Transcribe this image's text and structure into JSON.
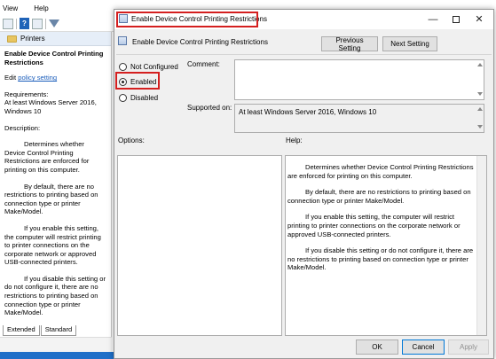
{
  "background": {
    "menu": [
      "View",
      "Help"
    ],
    "pane_header": "Printers",
    "pane_title": "Enable Device Control Printing Restrictions",
    "edit_prefix": "Edit",
    "edit_link": "policy setting",
    "requirements_label": "Requirements:",
    "requirements_text": "At least Windows Server 2016, Windows 10",
    "description_label": "Description:",
    "desc_p1": "Determines whether Device Control Printing Restrictions are enforced for printing on this computer.",
    "desc_p2": "By default, there are no restrictions to printing based on connection type or printer Make/Model.",
    "desc_p3": "If you enable this setting, the computer will restrict printing to printer connections on the corporate network or approved USB-connected printers.",
    "desc_p4": "If you disable this setting or do not configure it, there are no restrictions to printing based on connection type or printer Make/Model.",
    "tabs": [
      "Extended",
      "Standard"
    ]
  },
  "dialog": {
    "title": "Enable Device Control Printing Restrictions",
    "heading": "Enable Device Control Printing Restrictions",
    "prev_button": "Previous Setting",
    "next_button": "Next Setting",
    "radios": {
      "not_configured": "Not Configured",
      "enabled": "Enabled",
      "disabled": "Disabled",
      "selected": "enabled"
    },
    "comment_label": "Comment:",
    "supported_label": "Supported on:",
    "supported_value": "At least Windows Server 2016, Windows 10",
    "options_label": "Options:",
    "help_label": "Help:",
    "help": {
      "p1": "Determines whether Device Control Printing Restrictions are enforced for printing on this computer.",
      "p2": "By default, there are no restrictions to printing based on connection type or printer Make/Model.",
      "p3": "If you enable this setting, the computer will restrict printing to printer connections on the corporate network or approved USB-connected printers.",
      "p4": "If you disable this setting or do not configure it, there are no restrictions to printing based on connection type or printer Make/Model."
    },
    "ok_button": "OK",
    "cancel_button": "Cancel",
    "apply_button": "Apply"
  },
  "colors": {
    "highlight": "#d41f1f",
    "link": "#1a5dbb",
    "taskbar": "#1f6fc8"
  }
}
